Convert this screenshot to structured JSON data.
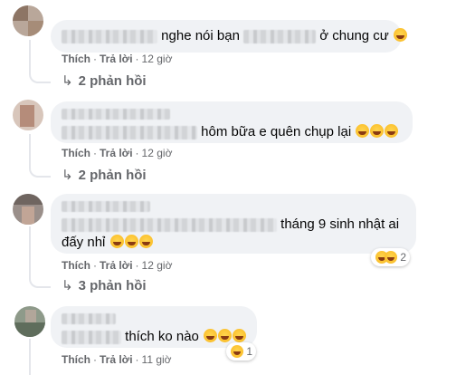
{
  "labels": {
    "like": "Thích",
    "reply": "Trả lời",
    "separator": "·"
  },
  "comments": [
    {
      "text_before": "",
      "text_after": "nghe nói bạn",
      "text_tail": "ở chung cư",
      "emojis": [
        "rolling-laugh-emoji"
      ],
      "time": "12 giờ",
      "replies": "2 phản hồi"
    },
    {
      "text_after": "hôm bữa e quên chụp lại",
      "emojis": [
        "sad-emoji",
        "sad-emoji",
        "sad-emoji"
      ],
      "time": "12 giờ",
      "replies": "2 phản hồi"
    },
    {
      "text_after": "tháng 9 sinh nhật ai",
      "text_line2": "đấy nhỉ",
      "emojis": [
        "grin-emoji",
        "laugh-emoji",
        "laugh-emoji"
      ],
      "time": "12 giờ",
      "replies": "3 phản hồi",
      "reaction_count": "2"
    },
    {
      "text_after": "thích ko nào",
      "emojis": [
        "rolling-laugh-emoji",
        "rolling-laugh-emoji",
        "rolling-laugh-emoji"
      ],
      "time": "11 giờ",
      "reaction_count": "1"
    }
  ]
}
